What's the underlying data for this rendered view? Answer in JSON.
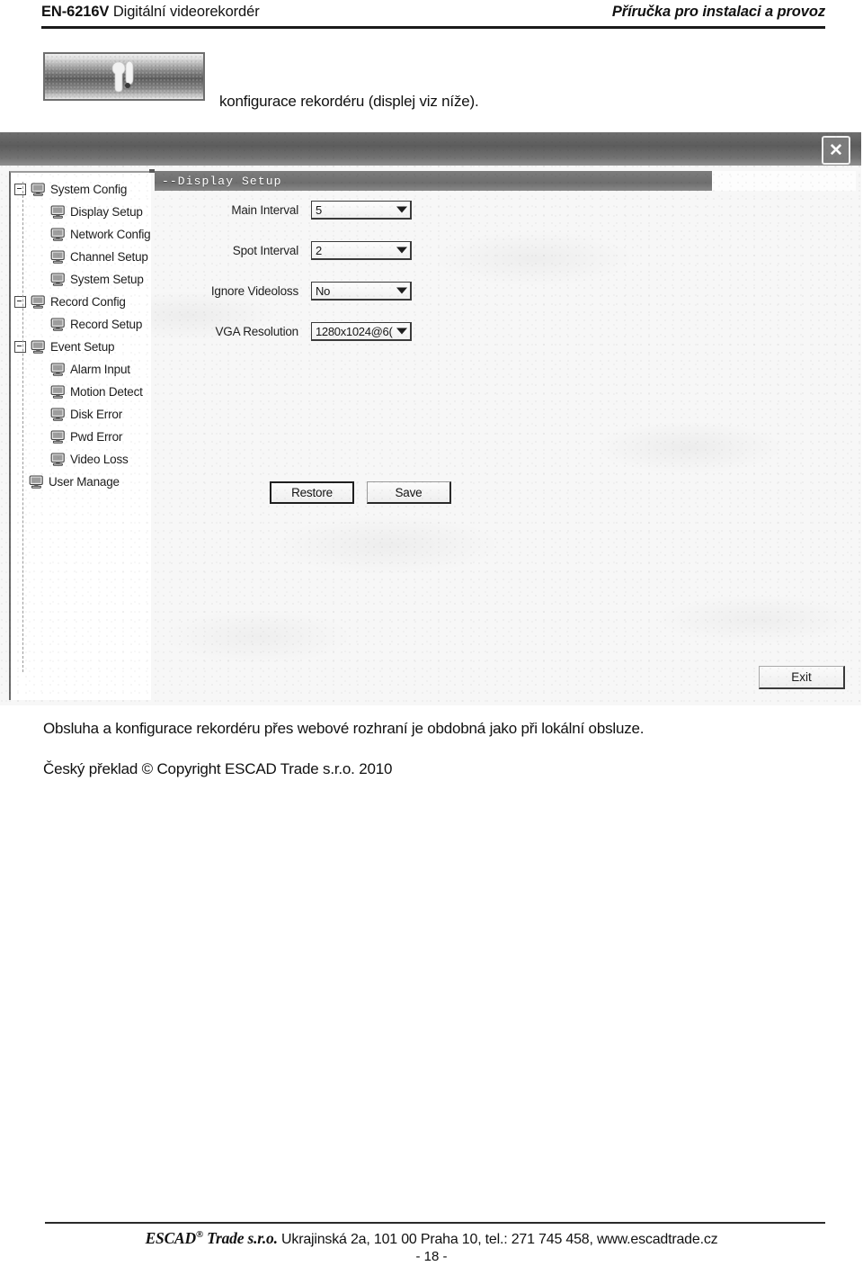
{
  "header": {
    "model": "EN-6216V",
    "product": "Digitální videorekordér",
    "right_title": "Příručka pro instalaci a provoz"
  },
  "intro": {
    "tool_icon": "wrench-tool-button",
    "text": "konfigurace rekordéru (displej viz níže)."
  },
  "dvr": {
    "close_label": "✕",
    "section_title": "--Display Setup",
    "tree": [
      {
        "label": "System Config",
        "level": 0,
        "expander": "minus",
        "icon": "monitor-icon"
      },
      {
        "label": "Display Setup",
        "level": 1,
        "expander": "none",
        "icon": "monitor-icon"
      },
      {
        "label": "Network Config",
        "level": 1,
        "expander": "none",
        "icon": "monitor-icon"
      },
      {
        "label": "Channel Setup",
        "level": 1,
        "expander": "none",
        "icon": "monitor-icon"
      },
      {
        "label": "System Setup",
        "level": 1,
        "expander": "none",
        "icon": "monitor-icon"
      },
      {
        "label": "Record Config",
        "level": 0,
        "expander": "minus",
        "icon": "monitor-icon"
      },
      {
        "label": "Record Setup",
        "level": 1,
        "expander": "none",
        "icon": "monitor-icon"
      },
      {
        "label": "Event Setup",
        "level": 0,
        "expander": "minus",
        "icon": "monitor-icon"
      },
      {
        "label": "Alarm Input",
        "level": 1,
        "expander": "none",
        "icon": "monitor-icon"
      },
      {
        "label": "Motion Detect",
        "level": 1,
        "expander": "none",
        "icon": "monitor-icon"
      },
      {
        "label": "Disk Error",
        "level": 1,
        "expander": "none",
        "icon": "monitor-icon"
      },
      {
        "label": "Pwd Error",
        "level": 1,
        "expander": "none",
        "icon": "monitor-icon"
      },
      {
        "label": "Video Loss",
        "level": 1,
        "expander": "none",
        "icon": "monitor-icon"
      },
      {
        "label": "User Manage",
        "level": 0,
        "expander": "none",
        "icon": "monitor-icon"
      }
    ],
    "fields": [
      {
        "label": "Main Interval",
        "value": "5"
      },
      {
        "label": "Spot Interval",
        "value": "2"
      },
      {
        "label": "Ignore Videoloss",
        "value": "No"
      },
      {
        "label": "VGA Resolution",
        "value": "1280x1024@6("
      }
    ],
    "buttons": {
      "restore": "Restore",
      "save": "Save",
      "exit": "Exit"
    }
  },
  "body": {
    "paragraph_1": "Obsluha a konfigurace rekordéru přes webové rozhraní je obdobná jako při lokální obsluze.",
    "paragraph_2": "Český překlad © Copyright ESCAD Trade s.r.o. 2010"
  },
  "footer": {
    "brand": "ESCAD",
    "brand_sup": "®",
    "brand_suffix": " Trade s.r.o.",
    "address": "Ukrajinská 2a, 101 00 Praha 10, tel.: 271 745 458, www.escadtrade.cz",
    "page_number": "- 18 -"
  }
}
